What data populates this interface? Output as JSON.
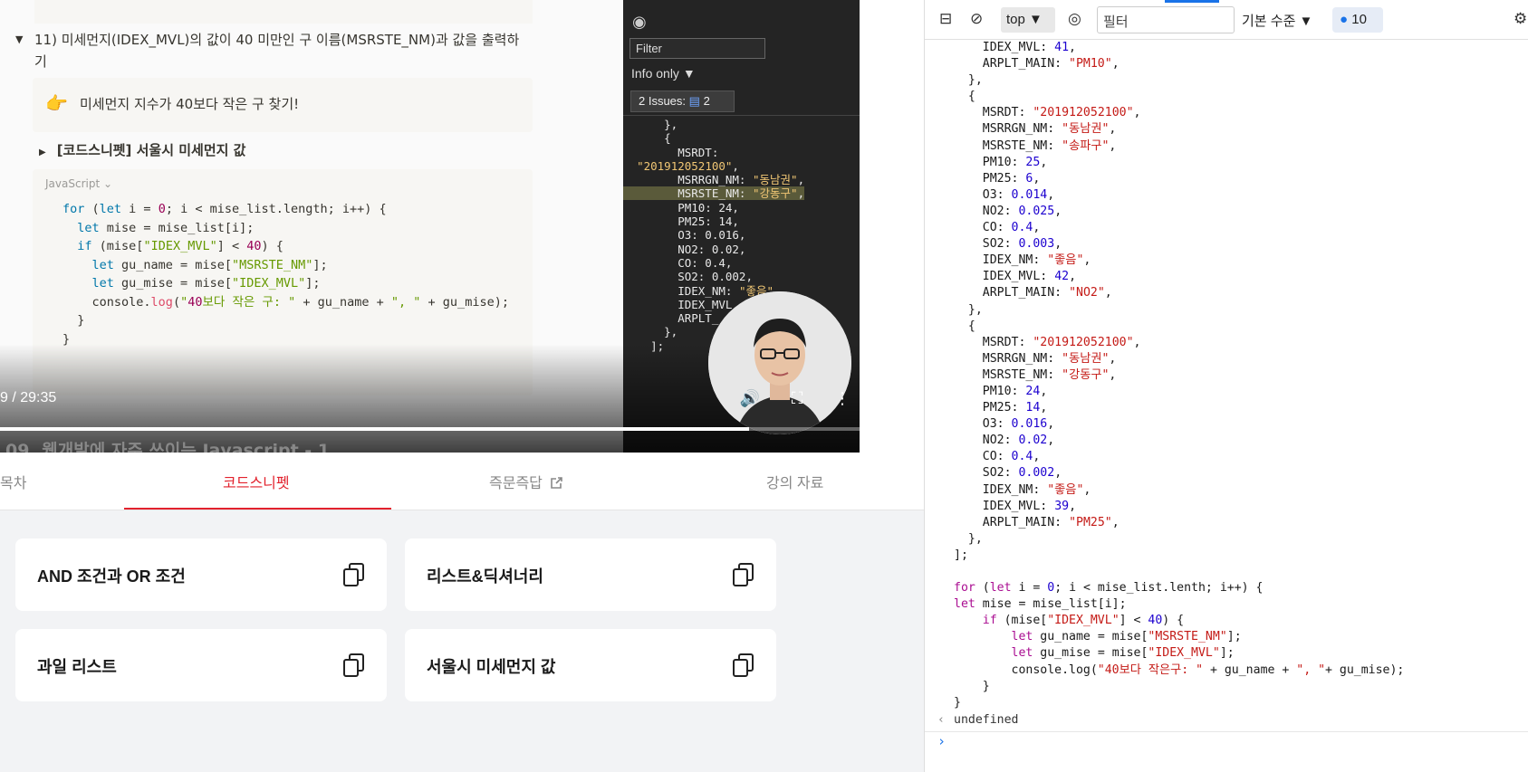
{
  "video": {
    "notebook": {
      "question": "11) 미세먼지(IDEX_MVL)의 값이 40 미만인 구 이름(MSRSTE_NM)과 값을 출력하기",
      "callout_emoji": "👉",
      "callout_text": "미세먼지 지수가 40보다 작은 구 찾기!",
      "toggle_label": "[코드스니펫] 서울시 미세먼지 값",
      "code_language": "JavaScript",
      "code_lines": [
        "for (let i = 0; i < mise_list.length; i++) {",
        "  let mise = mise_list[i];",
        "  if (mise[\"IDEX_MVL\"] < 40) {",
        "    let gu_name = mise[\"MSRSTE_NM\"];",
        "    let gu_mise = mise[\"IDEX_MVL\"];",
        "    console.log(\"40보다 작은 구: \" + gu_name + \", \" + gu_mise);",
        "  }",
        "}"
      ]
    },
    "mini_devtools": {
      "filter_placeholder": "Filter",
      "info_label": "Info only ▼",
      "issues_label": "2 Issues:",
      "issues_count": "2",
      "code_lines": [
        "      },",
        "      {",
        "        MSRDT:",
        "  \"201912052100\",",
        "        MSRRGN_NM: \"동남권\",",
        "        MSRSTE_NM: \"강동구\",",
        "        PM10: 24,",
        "        PM25: 14,",
        "        O3: 0.016,",
        "        NO2: 0.02,",
        "        CO: 0.4,",
        "        SO2: 0.002,",
        "        IDEX_NM: \"좋음\",",
        "        IDEX_MVL",
        "        ARPLT_",
        "      },",
        "    ];"
      ]
    },
    "time": "9 / 29:35",
    "progress": 0.871,
    "behind_title": "09. 웹개발에 자주 쓰이는 Javascript - 1"
  },
  "tabs": [
    {
      "label": "목차",
      "active": false
    },
    {
      "label": "코드스니펫",
      "active": true
    },
    {
      "label": "즉문즉답",
      "active": false,
      "icon": "external-link-icon"
    },
    {
      "label": "강의 자료",
      "active": false
    }
  ],
  "snippets": [
    {
      "label": "AND 조건과 OR 조건"
    },
    {
      "label": "리스트&딕셔너리"
    },
    {
      "label": "과일 리스트"
    },
    {
      "label": "서울시 미세먼지 값"
    }
  ],
  "console": {
    "context": "top",
    "filter_placeholder": "필터",
    "level": "기본 수준",
    "message_count": "10",
    "result": "undefined",
    "prompt": "›",
    "objects": [
      {
        "MSRDT": "201912052100",
        "MSRRGN_NM": "동남권",
        "MSRSTE_NM": "송파구",
        "PM10": 25,
        "PM25": 6,
        "O3": 0.014,
        "NO2": 0.025,
        "CO": 0.4,
        "SO2": 0.003,
        "IDEX_NM": "좋음",
        "IDEX_MVL": 42,
        "ARPLT_MAIN": "NO2"
      },
      {
        "MSRDT": "201912052100",
        "MSRRGN_NM": "동남권",
        "MSRSTE_NM": "강동구",
        "PM10": 24,
        "PM25": 14,
        "O3": 0.016,
        "NO2": 0.02,
        "CO": 0.4,
        "SO2": 0.002,
        "IDEX_NM": "좋음",
        "IDEX_MVL": 39,
        "ARPLT_MAIN": "PM25"
      }
    ],
    "head_lines": [
      "IDEX_MVL: 41,",
      "ARPLT_MAIN: \"PM10\","
    ],
    "code_lines": [
      "for (let i = 0; i < mise_list.lenth; i++) {",
      "let mise = mise_list[i];",
      "    if (mise[\"IDEX_MVL\"] < 40) {",
      "        let gu_name = mise[\"MSRSTE_NM\"];",
      "        let gu_mise = mise[\"IDEX_MVL\"];",
      "        console.log(\"40보다 작은구: \" + gu_name + \", \"+ gu_mise);",
      "    }",
      "}"
    ]
  }
}
